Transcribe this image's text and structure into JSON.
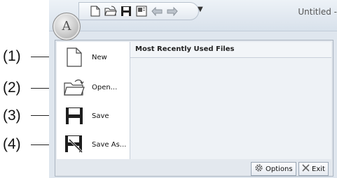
{
  "callouts": [
    "(1)",
    "(2)",
    "(3)",
    "(4)"
  ],
  "window": {
    "title": "Untitled -"
  },
  "app_button": {
    "letter": "A"
  },
  "quick_access": [
    "new-doc-icon",
    "open-folder-icon",
    "save-disk-icon",
    "print-preview-icon",
    "undo-icon",
    "redo-icon"
  ],
  "menu": {
    "items": [
      {
        "label": "New",
        "icon": "new-document-icon"
      },
      {
        "label": "Open...",
        "icon": "open-folder-icon"
      },
      {
        "label": "Save",
        "icon": "save-disk-icon"
      },
      {
        "label": "Save As...",
        "icon": "save-as-icon"
      }
    ],
    "mru_title": "Most Recently Used Files"
  },
  "buttons": {
    "options": "Options",
    "exit": "Exit"
  },
  "colors": {
    "title_bar": "#dfe6ee",
    "panel": "#e3e8ee"
  }
}
